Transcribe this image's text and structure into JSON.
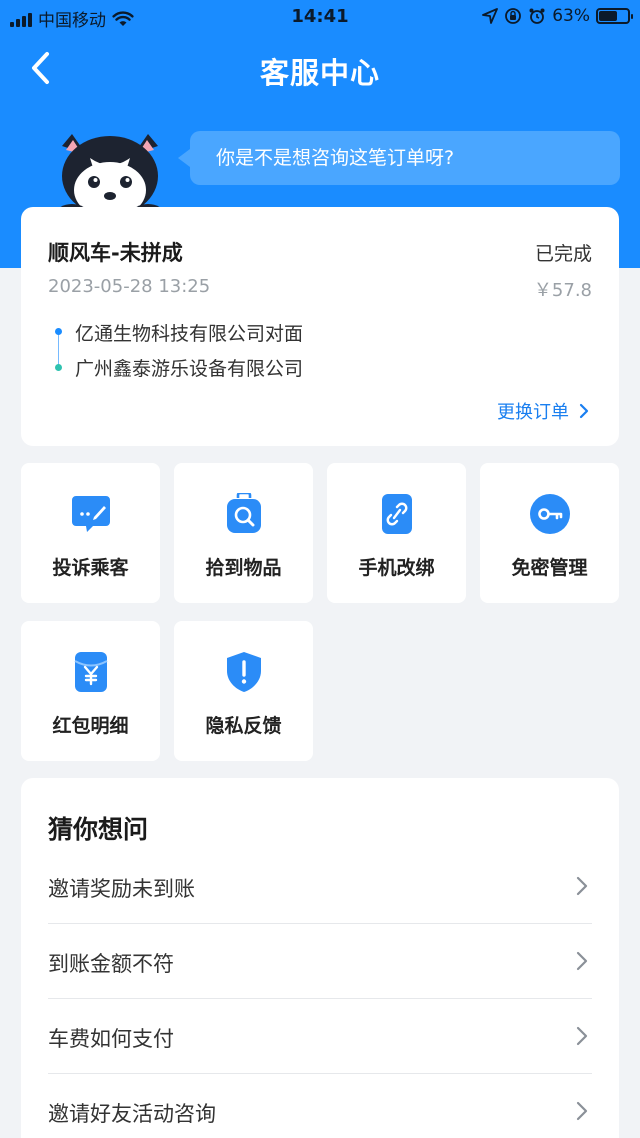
{
  "status_bar": {
    "carrier": "中国移动",
    "time": "14:41",
    "battery_text": "63%",
    "battery_level": 0.63
  },
  "nav": {
    "title": "客服中心",
    "back_icon": "chevron-left-icon"
  },
  "bubble": {
    "text": "你是不是想咨询这笔订单呀?"
  },
  "order": {
    "title": "顺风车-未拼成",
    "status": "已完成",
    "datetime": "2023-05-28 13:25",
    "price": "￥57.8",
    "from": "亿通生物科技有限公司对面",
    "to": "广州鑫泰游乐设备有限公司",
    "change_label": "更换订单"
  },
  "services": [
    {
      "label": "投诉乘客",
      "icon": "complaint-chat-icon"
    },
    {
      "label": "拾到物品",
      "icon": "lost-item-bag-icon"
    },
    {
      "label": "手机改绑",
      "icon": "phone-link-icon"
    },
    {
      "label": "免密管理",
      "icon": "key-icon"
    },
    {
      "label": "红包明细",
      "icon": "red-packet-yuan-icon"
    },
    {
      "label": "隐私反馈",
      "icon": "shield-alert-icon"
    }
  ],
  "faq": {
    "title": "猜你想问",
    "items": [
      {
        "label": "邀请奖励未到账"
      },
      {
        "label": "到账金额不符"
      },
      {
        "label": "车费如何支付"
      },
      {
        "label": "邀请好友活动咨询"
      }
    ]
  },
  "colors": {
    "brand_blue": "#1a8cff",
    "bubble_blue": "#4aa6ff",
    "page_bg": "#f1f3f6",
    "link_blue": "#1a7ff0",
    "teal_dot": "#2fc2b0"
  }
}
